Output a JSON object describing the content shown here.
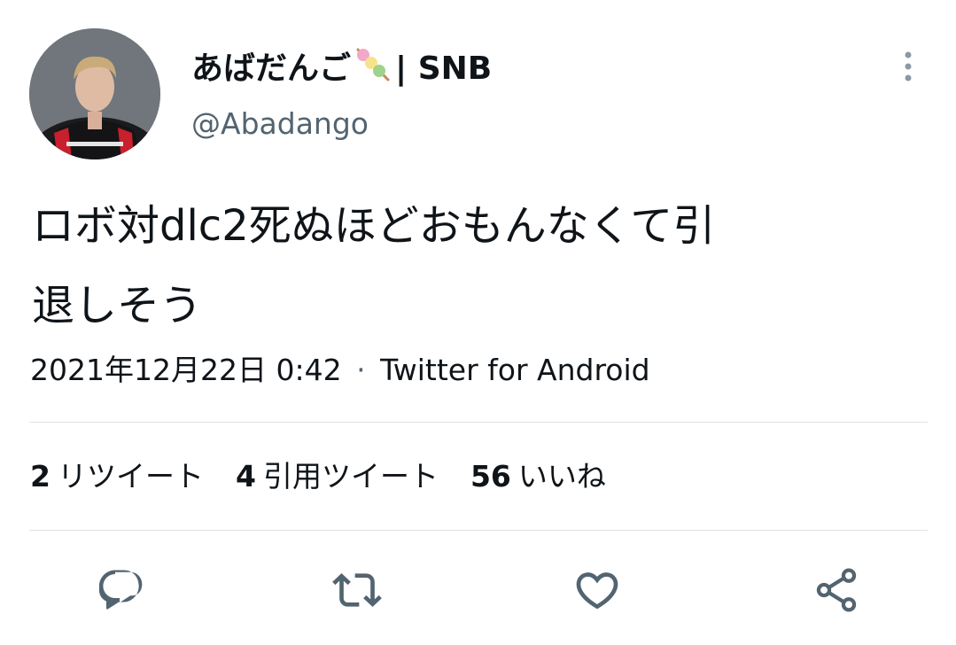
{
  "user": {
    "display_name": "あばだんご",
    "name_suffix": "| SNB",
    "handle": "@Abadango",
    "avatar_icon": "profile-photo"
  },
  "tweet": {
    "text_line1": "ロボ対dlc2死ぬほどおもんなくて引",
    "text_line2": "退しそう",
    "datetime": "2021年12月22日 0:42",
    "separator": "·",
    "source": "Twitter for Android"
  },
  "stats": {
    "retweets_count": "2",
    "retweets_label": "リツイート",
    "quotes_count": "4",
    "quotes_label": "引用ツイート",
    "likes_count": "56",
    "likes_label": "いいね"
  },
  "actions": [
    "reply-icon",
    "retweet-icon",
    "like-icon",
    "share-icon"
  ],
  "colors": {
    "text": "#0f1419",
    "secondary": "#536471",
    "icon": "#536471",
    "divider": "#dfe3e6"
  }
}
